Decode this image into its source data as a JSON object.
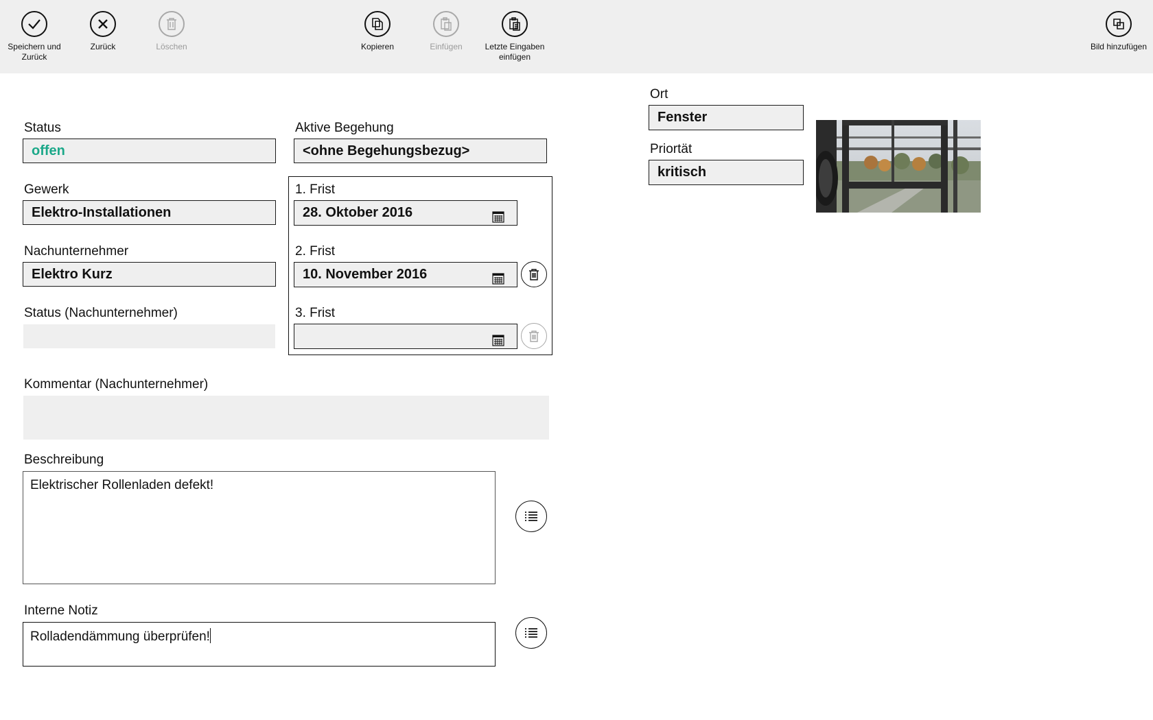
{
  "appbar": {
    "left": [
      {
        "label": "Speichern und Zurück",
        "icon": "checkmark-icon",
        "enabled": true
      },
      {
        "label": "Zurück",
        "icon": "close-icon",
        "enabled": true
      },
      {
        "label": "Löschen",
        "icon": "trash-icon",
        "enabled": false
      }
    ],
    "center": [
      {
        "label": "Kopieren",
        "icon": "copy-icon",
        "enabled": true
      },
      {
        "label": "Einfügen",
        "icon": "paste-icon",
        "enabled": false
      },
      {
        "label": "Letzte Eingaben einfügen",
        "icon": "paste-recent-icon",
        "enabled": true
      }
    ],
    "right": [
      {
        "label": "Bild hinzufügen",
        "icon": "add-image-icon",
        "enabled": true
      }
    ]
  },
  "form": {
    "status": {
      "label": "Status",
      "value": "offen",
      "value_color": "#1ba889"
    },
    "aktive_begehung": {
      "label": "Aktive Begehung",
      "value": "<ohne Begehungsbezug>"
    },
    "gewerk": {
      "label": "Gewerk",
      "value": "Elektro-Installationen"
    },
    "nachunternehmer": {
      "label": "Nachunternehmer",
      "value": "Elektro Kurz"
    },
    "status_nu": {
      "label": "Status (Nachunternehmer)",
      "value": ""
    },
    "fristen": [
      {
        "label": "1. Frist",
        "value": "28. Oktober 2016",
        "delete_enabled": null
      },
      {
        "label": "2. Frist",
        "value": "10. November 2016",
        "delete_enabled": true
      },
      {
        "label": "3. Frist",
        "value": "",
        "delete_enabled": false
      }
    ],
    "kommentar_nu": {
      "label": "Kommentar (Nachunternehmer)",
      "value": ""
    },
    "beschreibung": {
      "label": "Beschreibung",
      "value": "Elektrischer Rollenladen defekt!"
    },
    "interne_notiz": {
      "label": "Interne Notiz",
      "value": "Rolladendämmung überprüfen!"
    },
    "ort": {
      "label": "Ort",
      "value": "Fenster"
    },
    "prioritaet": {
      "label": "Priortät",
      "value": "kritisch"
    }
  },
  "colors": {
    "accent_green": "#1ba889",
    "appbar_bg": "#efefef",
    "field_bg": "#efefef"
  }
}
